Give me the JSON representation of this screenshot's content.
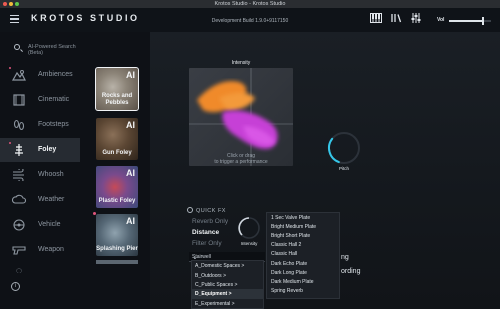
{
  "titlebar": {
    "title": "Krotos Studio - Krotos Studio"
  },
  "header": {
    "brand": "KROTOS STUDIO",
    "build": "Development Build 1.9.0+9117150",
    "icons": [
      "piano-keys-icon",
      "library-icon",
      "mixer-sliders-icon"
    ],
    "vol_label": "Vol",
    "vol_level": 0.8
  },
  "sidebar": {
    "search_placeholder": "AI-Powered Search (Beta)",
    "categories": [
      {
        "label": "Ambiences",
        "icon": "ambience-icon"
      },
      {
        "label": "Cinematic",
        "icon": "film-icon"
      },
      {
        "label": "Footsteps",
        "icon": "footsteps-icon"
      },
      {
        "label": "Foley",
        "icon": "foley-icon"
      },
      {
        "label": "Whoosh",
        "icon": "whoosh-icon"
      },
      {
        "label": "Weather",
        "icon": "weather-icon"
      },
      {
        "label": "Vehicle",
        "icon": "vehicle-icon"
      },
      {
        "label": "Weapon",
        "icon": "weapon-icon"
      }
    ],
    "info_label": "i"
  },
  "thumbnails": [
    {
      "ai": "AI",
      "title": "Rocks and Pebbles"
    },
    {
      "ai": "AI",
      "title": "Gun Foley"
    },
    {
      "ai": "AI",
      "title": "Plastic Foley"
    },
    {
      "ai": "AI",
      "title": "Splashing Pier"
    }
  ],
  "pad": {
    "title": "Intensity",
    "hint_line1": "Click or drag",
    "hint_line2": "to trigger a performance"
  },
  "pitch": {
    "label": "Pitch",
    "value": 0.3
  },
  "quickfx": {
    "title": "QUICK FX",
    "options": [
      "Reverb Only",
      "Distance",
      "Filter Only"
    ],
    "intensity_label": "Intensity",
    "select_value": "Stairwell"
  },
  "side_texts": [
    "ng",
    "ording"
  ],
  "folder_menu": [
    {
      "label": "A_Domestic Spaces >"
    },
    {
      "label": "B_Outdoors >"
    },
    {
      "label": "C_Public Spaces >"
    },
    {
      "label": "D_Equipment >"
    },
    {
      "label": "E_Experimental >"
    }
  ],
  "reverb_menu": [
    "1 Sec Valve Plate",
    "Bright Medium Plate",
    "Bright Short Plate",
    "Classic Hall 2",
    "Classic Hall",
    "Dark Echo Plate",
    "Dark Long Plate",
    "Dark Medium Plate",
    "Spring Reverb"
  ],
  "colors": {
    "accent": "#35c6e8",
    "pad_orange": "#f08a2a",
    "pad_purple": "#c63fd6",
    "dot": "#e0557c"
  }
}
